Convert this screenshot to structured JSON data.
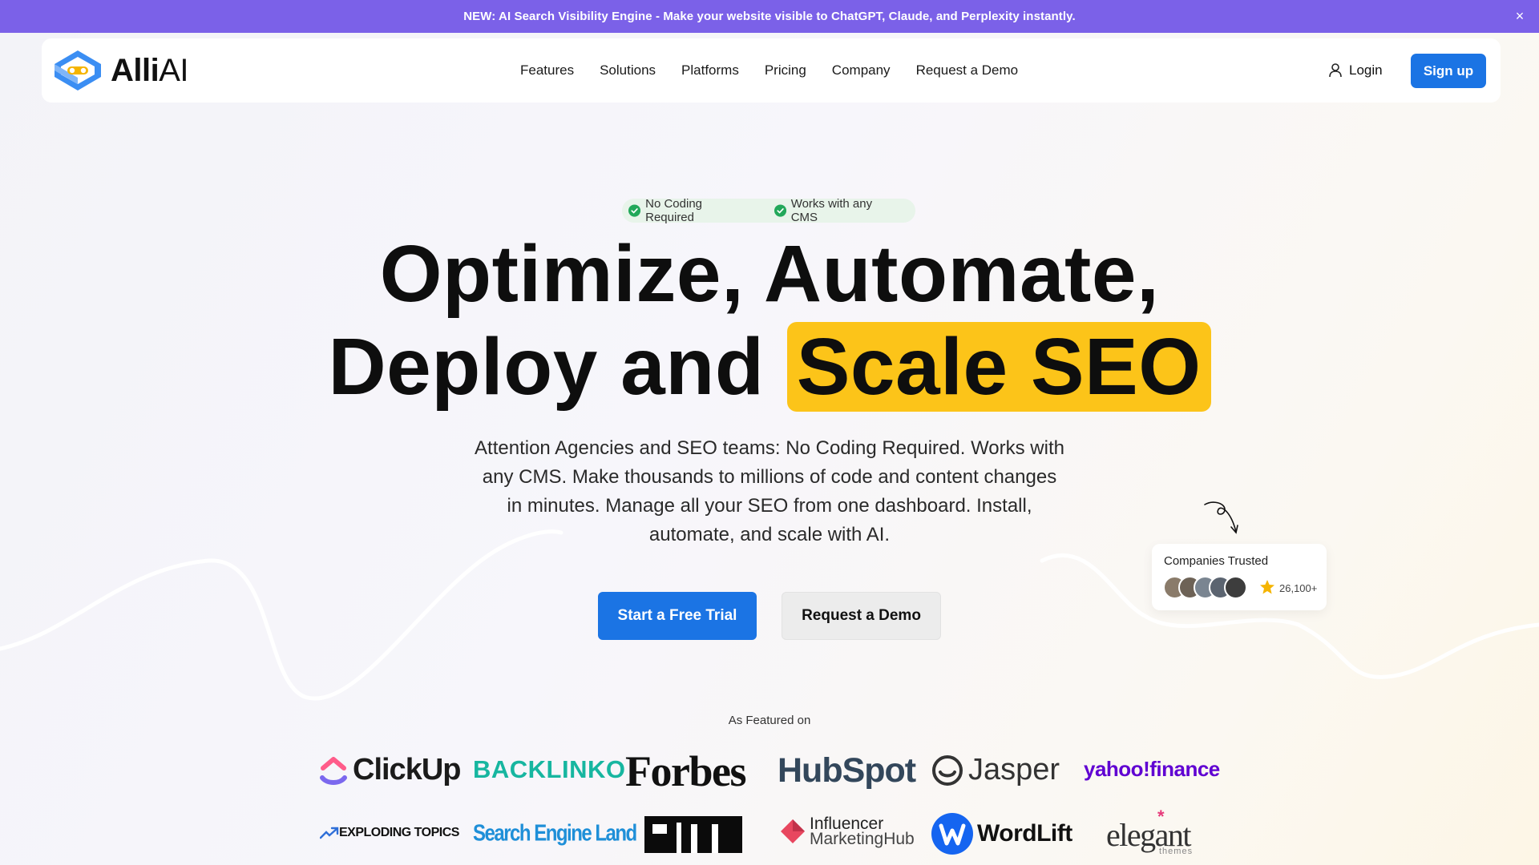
{
  "announcement": {
    "text": "NEW: AI Search Visibility Engine - Make your website visible to ChatGPT, Claude, and Perplexity instantly.",
    "close_glyph": "×"
  },
  "header": {
    "logo_bold": "Alli",
    "logo_light": "AI",
    "nav": [
      "Features",
      "Solutions",
      "Platforms",
      "Pricing",
      "Company",
      "Request a Demo"
    ],
    "login_label": "Login",
    "signup_label": "Sign up"
  },
  "hero": {
    "badges": [
      "No Coding Required",
      "Works with any CMS"
    ],
    "title_line1": "Optimize, Automate,",
    "title_line2_prefix": "Deploy and",
    "title_highlight": "Scale SEO",
    "subtitle": "Attention Agencies and SEO teams: No Coding Required. Works with any CMS. Make thousands to millions of code and content changes in minutes. Manage all your SEO from one dashboard. Install, automate, and scale with AI.",
    "primary_cta": "Start a Free Trial",
    "secondary_cta": "Request a Demo"
  },
  "trust": {
    "title": "Companies Trusted",
    "count": "26,100+"
  },
  "featured": {
    "label": "As Featured on",
    "logos": {
      "clickup": "ClickUp",
      "backlinko": "BACKLINKO",
      "forbes": "Forbes",
      "hubspot": "HubSpot",
      "jasper": "Jasper",
      "yahoo": "yahoo!finance",
      "exploding": "EXPLODING TOPICS",
      "sel": "Search Engine Land",
      "influencer_1": "Influencer",
      "influencer_2": "MarketingHub",
      "wordlift": "WordLift",
      "elegant": "elegant",
      "elegant_sub": "themes"
    }
  },
  "colors": {
    "announce_bg": "#7b61e8",
    "primary": "#1b74e4",
    "highlight": "#fcc419",
    "badge_check": "#22a85a"
  }
}
